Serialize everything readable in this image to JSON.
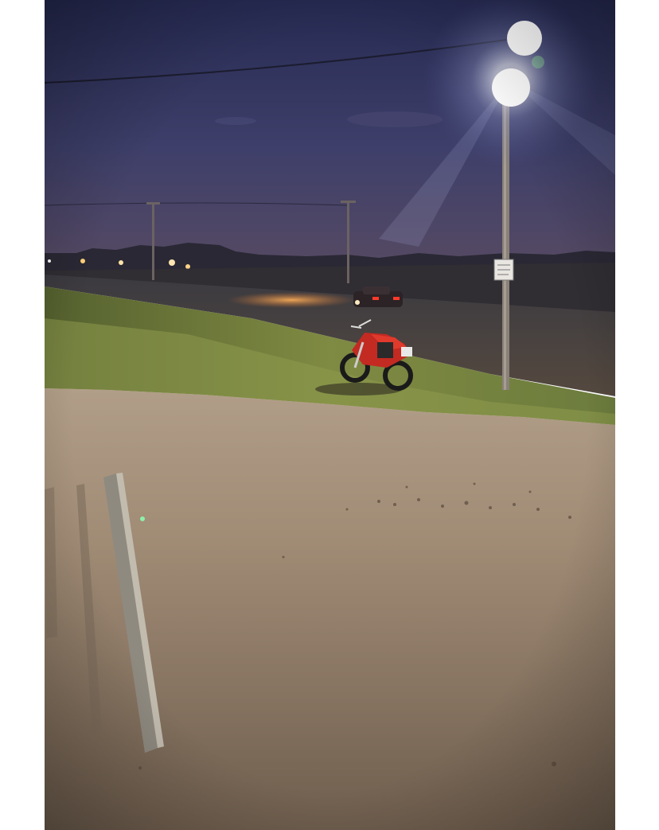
{
  "image": {
    "kind": "photograph",
    "colors": {
      "sky_top": "#2b2f57",
      "sky_mid": "#3d3f6a",
      "sky_horizon": "#4d4662",
      "treeline": "#2b2a35",
      "grass": "#6f7a3a",
      "road": "#4a443f",
      "dirt": "#9a8570",
      "lamp_light": "#ffffff",
      "motorcycle": "#c22a22",
      "car_glow": "#f0a040"
    },
    "icons": [
      "street-lamp",
      "utility-pole",
      "motorcycle",
      "car",
      "sign-plate"
    ]
  }
}
